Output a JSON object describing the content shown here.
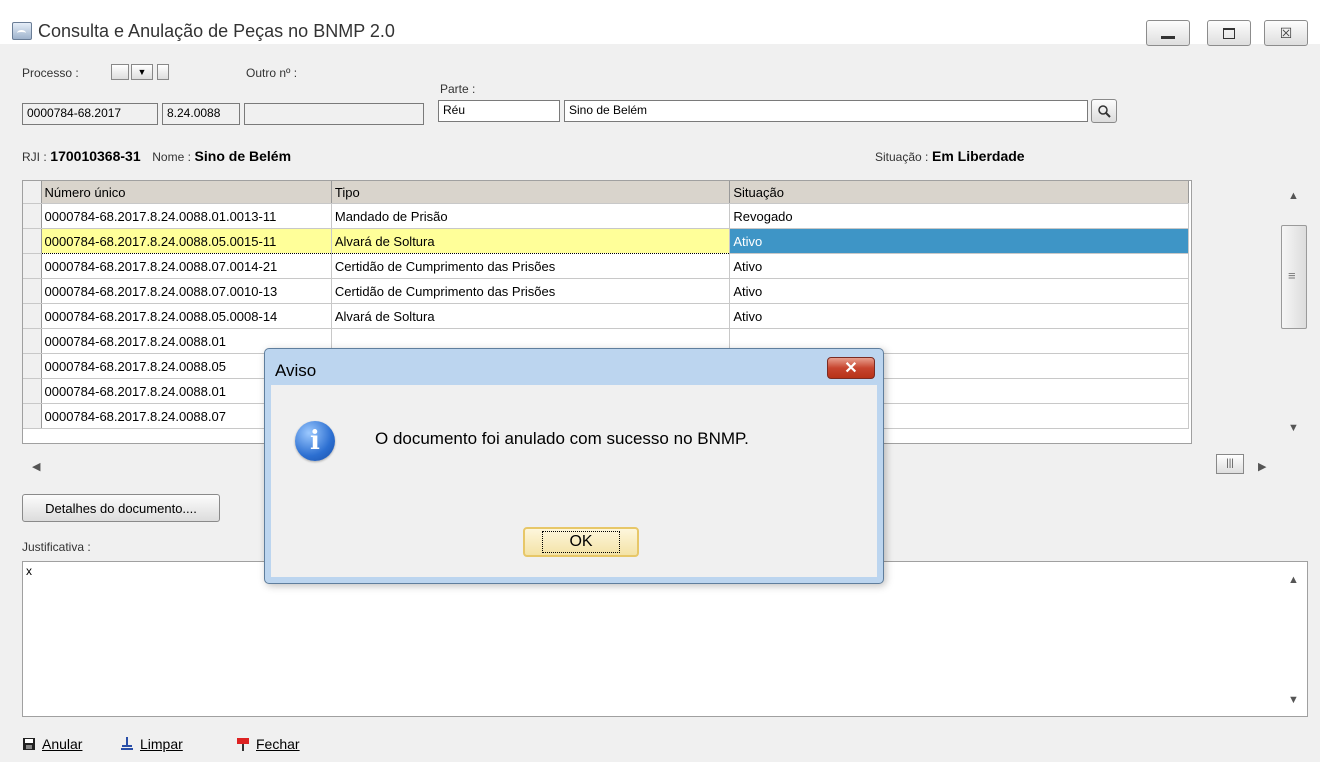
{
  "window": {
    "title": "Consulta e Anulação de Peças no BNMP 2.0",
    "minimize_icon": "minimize-icon",
    "maximize_icon": "maximize-icon",
    "close_glyph": "☒"
  },
  "form": {
    "processo_label": "Processo :",
    "outro_label": "Outro nº :",
    "parte_label": "Parte :",
    "processo_num": "0000784-68.2017",
    "processo_org": "8.24.0088",
    "outro_value": "",
    "parte_tipo": "Réu",
    "parte_nome": "Sino de Belém"
  },
  "info": {
    "rji_label": "RJI :",
    "rji_value": "170010368-31",
    "nome_label": "Nome :",
    "nome_value": "Sino de Belém",
    "situacao_label": "Situação :",
    "situacao_value": "Em Liberdade"
  },
  "table": {
    "headers": [
      "Número único",
      "Tipo",
      "Situação"
    ],
    "rows": [
      {
        "numero": "0000784-68.2017.8.24.0088.01.0013-11",
        "tipo": "Mandado de Prisão",
        "situacao": "Revogado"
      },
      {
        "numero": "0000784-68.2017.8.24.0088.05.0015-11",
        "tipo": "Alvará de Soltura",
        "situacao": "Ativo"
      },
      {
        "numero": "0000784-68.2017.8.24.0088.07.0014-21",
        "tipo": "Certidão de Cumprimento das Prisões",
        "situacao": "Ativo"
      },
      {
        "numero": "0000784-68.2017.8.24.0088.07.0010-13",
        "tipo": "Certidão de Cumprimento das Prisões",
        "situacao": "Ativo"
      },
      {
        "numero": "0000784-68.2017.8.24.0088.05.0008-14",
        "tipo": "Alvará de Soltura",
        "situacao": "Ativo"
      },
      {
        "numero": "0000784-68.2017.8.24.0088.01",
        "tipo": "",
        "situacao": ""
      },
      {
        "numero": "0000784-68.2017.8.24.0088.05",
        "tipo": "",
        "situacao": ""
      },
      {
        "numero": "0000784-68.2017.8.24.0088.01",
        "tipo": "",
        "situacao": ""
      },
      {
        "numero": "0000784-68.2017.8.24.0088.07",
        "tipo": "",
        "situacao": ""
      }
    ]
  },
  "buttons": {
    "detalhes": "Detalhes do documento....",
    "justificativa_label": "Justificativa :",
    "justificativa_value": "x"
  },
  "toolbar": {
    "anular": "Anular",
    "limpar": "Limpar",
    "fechar": "Fechar"
  },
  "dialog": {
    "title": "Aviso",
    "message": "O documento foi anulado com sucesso no BNMP.",
    "ok": "OK",
    "close_glyph": "✕",
    "info_glyph": "i"
  },
  "colors": {
    "selection_yellow": "#ffff99",
    "selection_blue": "#3e95c6",
    "dialog_frame": "#bcd5ef"
  }
}
